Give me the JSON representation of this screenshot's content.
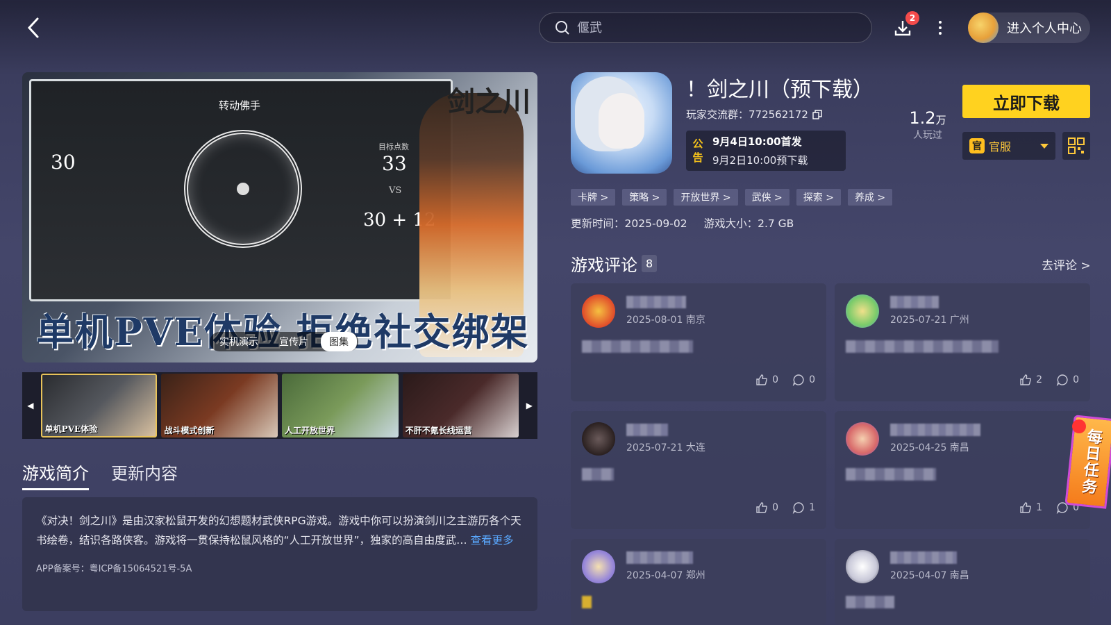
{
  "nav": {
    "back_icon": "chevron-left-icon"
  },
  "search": {
    "placeholder": "偃武"
  },
  "downloads": {
    "badge": "2"
  },
  "user": {
    "label": "进入个人中心"
  },
  "banner": {
    "panel_title": "转动佛手",
    "left_value": "30",
    "target_label": "目标点数",
    "target_value": "33",
    "vs": "VS",
    "result_value": "30 + 12",
    "logo": "剑之川",
    "headline": "单机PVE体验 拒绝社交绑架",
    "media_tabs": [
      "实机演示",
      "宣传片",
      "图集"
    ],
    "active_tab": "图集"
  },
  "thumbnails": [
    {
      "caption": "单机PVE体验"
    },
    {
      "caption": "战斗模式创新"
    },
    {
      "caption": "人工开放世界"
    },
    {
      "caption": "不肝不氪长线运营"
    }
  ],
  "intro": {
    "tabs": [
      "游戏简介",
      "更新内容"
    ],
    "text": "《对决！剑之川》是由汉家松鼠开发的幻想题材武侠RPG游戏。游戏中你可以扮演剑川之主游历各个天书绘卷，结识各路侠客。游戏将一贯保持松鼠风格的“人工开放世界”，独家的高自由度武…",
    "more": "查看更多",
    "icp": "APP备案号：粤ICP备15064521号-5A"
  },
  "game": {
    "title": "！剑之川（预下载）",
    "group": "玩家交流群：772562172",
    "notice_tag": "公告",
    "notice_line1": "9月4日10:00首发",
    "notice_line2": "9月2日10:00预下载",
    "players_num": "1.2",
    "players_unit": "万",
    "players_label": "人玩过",
    "download_label": "立即下载",
    "server_badge": "官",
    "server_label": "官服",
    "tags": [
      "卡牌 >",
      "策略 >",
      "开放世界 >",
      "武侠 >",
      "探索 >",
      "养成 >"
    ],
    "update_time": "更新时间：2025-09-02",
    "size": "游戏大小：2.7 GB"
  },
  "reviews": {
    "title": "游戏评论",
    "count": "8",
    "link": "去评论 >",
    "items": [
      {
        "meta": "2025-08-01 南京",
        "likes": "0",
        "comments": "0"
      },
      {
        "meta": "2025-07-21 广州",
        "likes": "2",
        "comments": "0"
      },
      {
        "meta": "2025-07-21 大连",
        "likes": "0",
        "comments": "1"
      },
      {
        "meta": "2025-04-25 南昌",
        "likes": "1",
        "comments": "0"
      },
      {
        "meta": "2025-04-07 郑州",
        "likes": "",
        "comments": ""
      },
      {
        "meta": "2025-04-07 南昌",
        "likes": "",
        "comments": ""
      }
    ]
  },
  "daily_task": {
    "label": "每日任务"
  },
  "colors": {
    "accent": "#ffd21f",
    "badge": "#f44b4b",
    "link": "#5aa9ff"
  }
}
